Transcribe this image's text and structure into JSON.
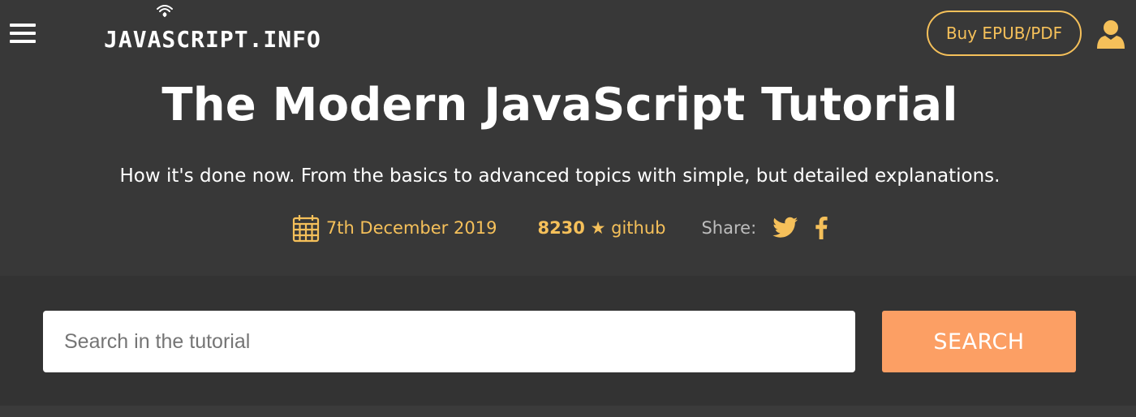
{
  "header": {
    "logo_text": "JAVASCRIPT.INFO",
    "buy_label": "Buy EPUB/PDF",
    "menu_icon": "hamburger-menu-icon",
    "user_icon": "user-icon"
  },
  "hero": {
    "title": "The Modern JavaScript Tutorial",
    "subtitle": "How it's done now. From the basics to advanced topics with simple, but detailed explanations.",
    "date": "7th December 2019",
    "github_stars": "8230",
    "github_star_glyph": "★",
    "github_label": "github",
    "share_label": "Share:",
    "share_icons": [
      "twitter-icon",
      "facebook-icon"
    ]
  },
  "search": {
    "placeholder": "Search in the tutorial",
    "value": "",
    "button_label": "SEARCH"
  },
  "colors": {
    "background": "#383838",
    "accent": "#f5c05a",
    "search_button": "#fc9f64",
    "text": "#ffffff",
    "muted": "#bdbdbd"
  }
}
